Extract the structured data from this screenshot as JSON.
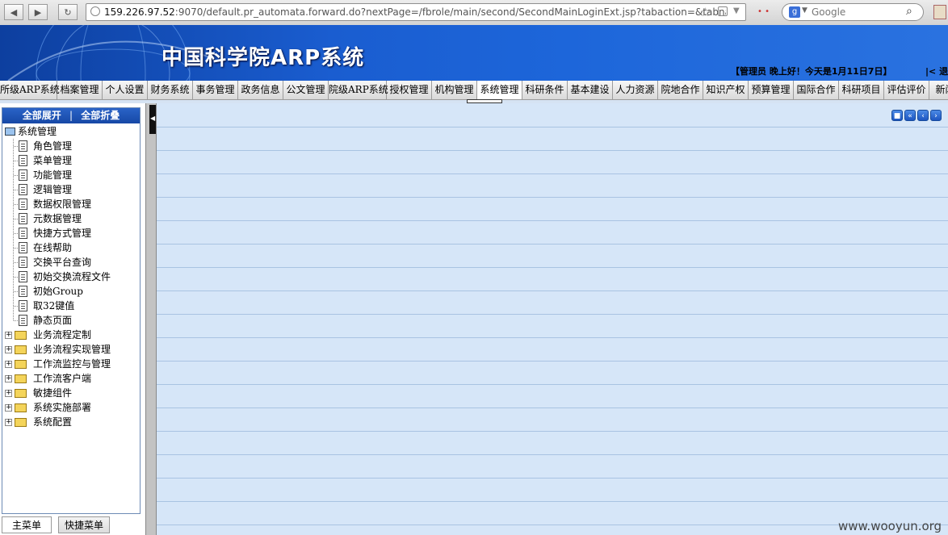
{
  "browser": {
    "url_host": "159.226.97.52",
    "url_rest": ":9070/default.pr_automata.forward.do?nextPage=/fbrole/main/second/SecondMainLoginExt.jsp?tabaction=&tabnan",
    "search_placeholder": "Google"
  },
  "header": {
    "title": "中国科学院ARP系统",
    "greeting": "【管理员 晚上好！今天是1月11日7日】",
    "logout": "|< 退"
  },
  "tabs": [
    {
      "label": "所级ARP系统"
    },
    {
      "label": "档案管理"
    },
    {
      "label": "个人设置"
    },
    {
      "label": "财务系统"
    },
    {
      "label": "事务管理"
    },
    {
      "label": "政务信息"
    },
    {
      "label": "公文管理"
    },
    {
      "label": "院级ARP系统"
    },
    {
      "label": "授权管理"
    },
    {
      "label": "机构管理"
    },
    {
      "label": "系统管理"
    },
    {
      "label": "科研条件"
    },
    {
      "label": "基本建设"
    },
    {
      "label": "人力资源"
    },
    {
      "label": "院地合作"
    },
    {
      "label": "知识产权"
    },
    {
      "label": "预算管理"
    },
    {
      "label": "国际合作"
    },
    {
      "label": "科研项目"
    },
    {
      "label": "评估评价"
    },
    {
      "label": "新闻"
    }
  ],
  "sidebar": {
    "expand_all": "全部展开",
    "divider": "|",
    "collapse_all": "全部折叠",
    "root": "系统管理",
    "leaves": [
      "角色管理",
      "菜单管理",
      "功能管理",
      "逻辑管理",
      "数据权限管理",
      "元数据管理",
      "快捷方式管理",
      "在线帮助",
      "交换平台查询",
      "初始交换流程文件",
      "初始Group",
      "取32键值",
      "静态页面"
    ],
    "folders": [
      "业务流程定制",
      "业务流程实现管理",
      "工作流监控与管理",
      "工作流客户端",
      "敏捷组件",
      "系统实施部署",
      "系统配置"
    ],
    "bottom_tabs": {
      "main": "主菜单",
      "shortcut": "快捷菜单"
    }
  },
  "watermark": "www.wooyun.org"
}
